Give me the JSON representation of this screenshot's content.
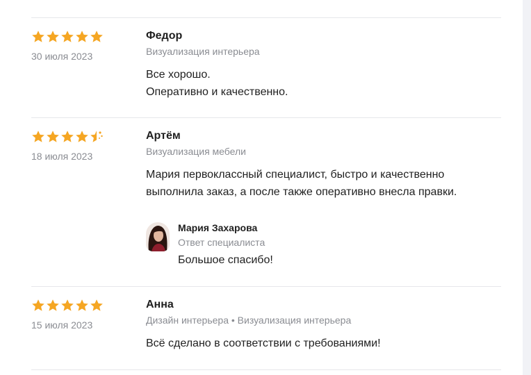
{
  "colors": {
    "star": "#f5a623",
    "muted": "#8a8c92",
    "divider": "#e6e7ea"
  },
  "reviews": [
    {
      "rating": 5,
      "date": "30 июля 2023",
      "author": "Федор",
      "category": "Визуализация интерьера",
      "text_lines": [
        "Все хорошо.",
        "Оперативно и качественно."
      ]
    },
    {
      "rating": 4.5,
      "date": "18 июля 2023",
      "author": "Артём",
      "category": "Визуализация мебели",
      "text_lines": [
        "Мария первоклассный специалист, быстро и качественно",
        "выполнила заказ, а после также оперативно внесла правки."
      ],
      "reply": {
        "author": "Мария Захарова",
        "role": "Ответ специалиста",
        "text": "Большое спасибо!",
        "avatar_icon": "specialist-avatar"
      }
    },
    {
      "rating": 5,
      "date": "15 июля 2023",
      "author": "Анна",
      "category": "Дизайн интерьера • Визуализация интерьера",
      "text_lines": [
        "Всё сделано в соответствии с требованиями!"
      ]
    }
  ]
}
